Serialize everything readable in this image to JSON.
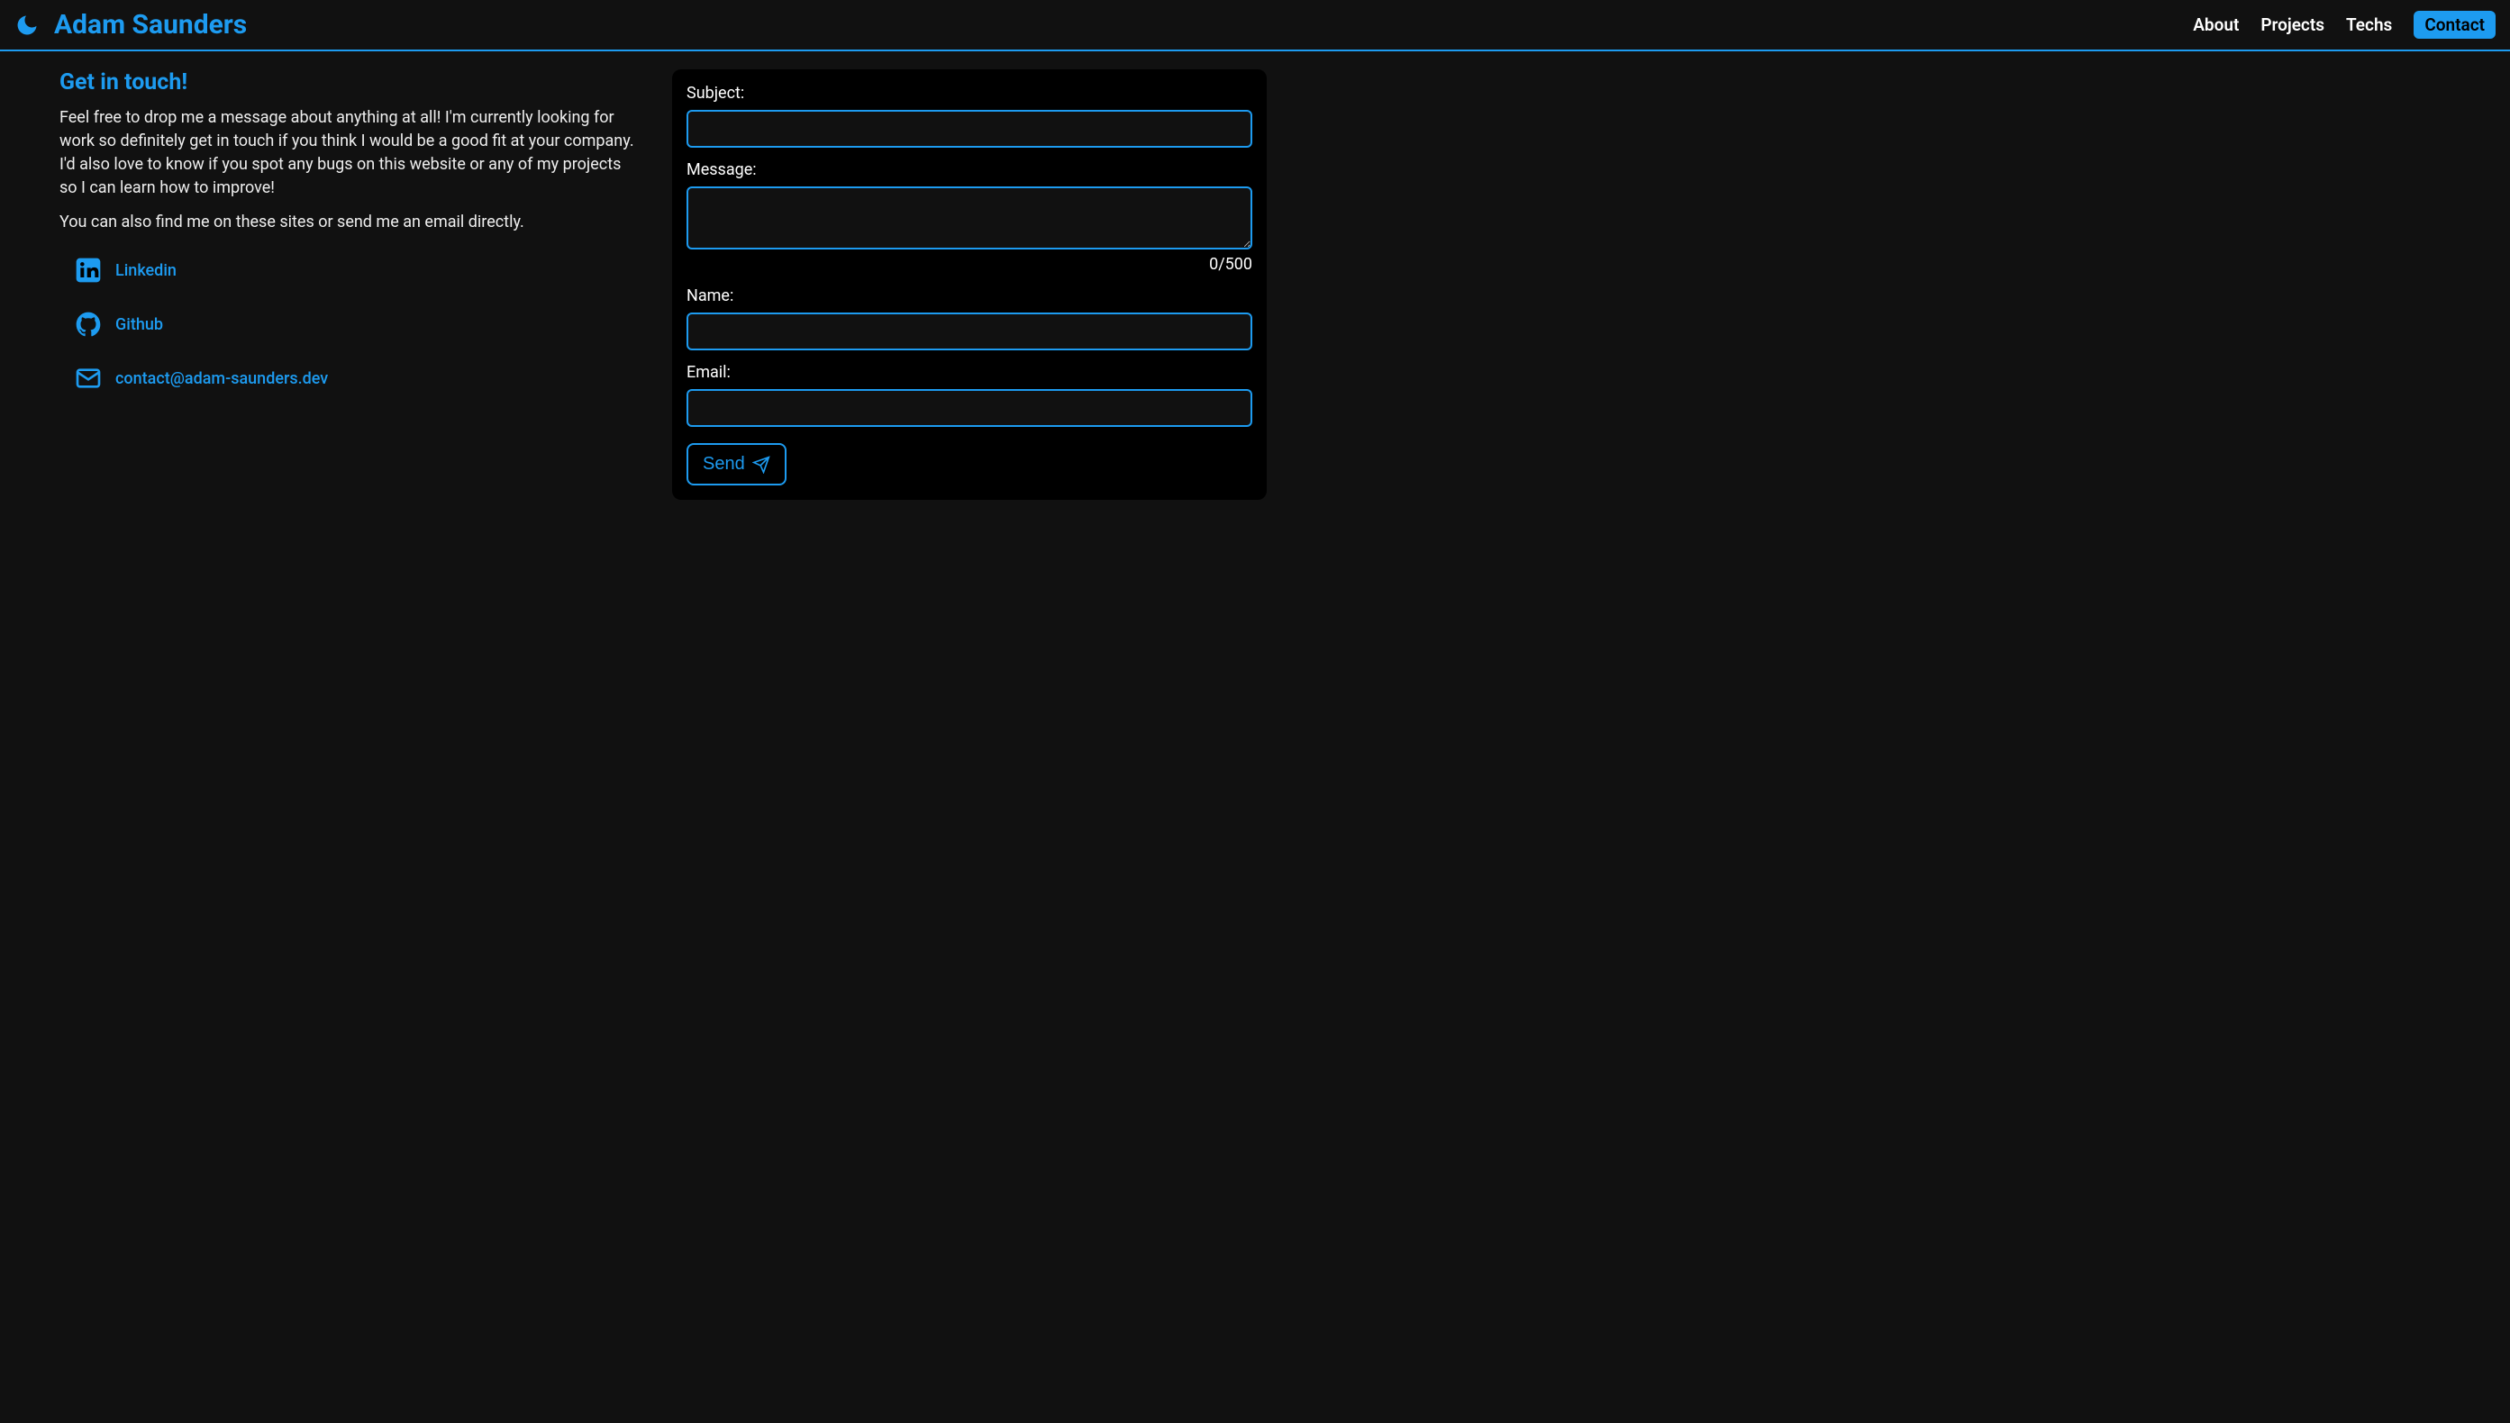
{
  "header": {
    "site_title": "Adam Saunders"
  },
  "nav": {
    "about": "About",
    "projects": "Projects",
    "techs": "Techs",
    "contact": "Contact"
  },
  "contact": {
    "title": "Get in touch!",
    "paragraph1": "Feel free to drop me a message about anything at all! I'm currently looking for work so definitely get in touch if you think I would be a good fit at your company. I'd also love to know if you spot any bugs on this website or any of my projects so I can learn how to improve!",
    "paragraph2": "You can also find me on these sites or send me an email directly.",
    "links": {
      "linkedin": "Linkedin",
      "github": "Github",
      "email": "contact@adam-saunders.dev"
    }
  },
  "form": {
    "subject_label": "Subject:",
    "message_label": "Message:",
    "name_label": "Name:",
    "email_label": "Email:",
    "char_counter": "0/500",
    "send_label": "Send"
  }
}
